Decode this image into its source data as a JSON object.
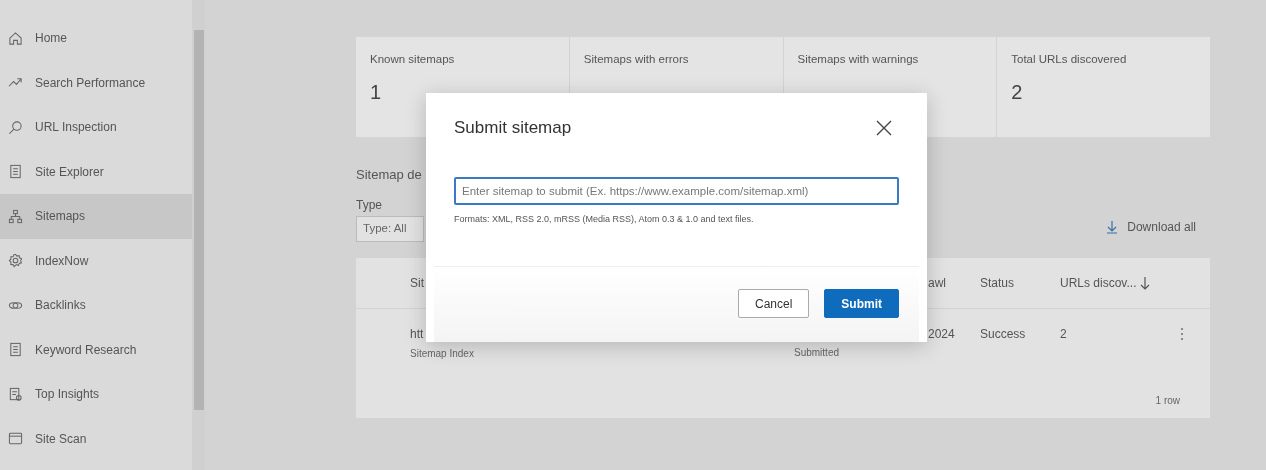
{
  "sidebar": {
    "items": [
      {
        "label": "Home",
        "selected": false
      },
      {
        "label": "Search Performance",
        "selected": false
      },
      {
        "label": "URL Inspection",
        "selected": false
      },
      {
        "label": "Site Explorer",
        "selected": false
      },
      {
        "label": "Sitemaps",
        "selected": true
      },
      {
        "label": "IndexNow",
        "selected": false
      },
      {
        "label": "Backlinks",
        "selected": false
      },
      {
        "label": "Keyword Research",
        "selected": false
      },
      {
        "label": "Top Insights",
        "selected": false
      },
      {
        "label": "Site Scan",
        "selected": false
      }
    ]
  },
  "stats": [
    {
      "label": "Known sitemaps",
      "value": "1"
    },
    {
      "label": "Sitemaps with errors"
    },
    {
      "label": "Sitemaps with warnings"
    },
    {
      "label": "Total URLs discovered",
      "value": "2"
    }
  ],
  "section_title": "Sitemap de",
  "type_filter": {
    "label": "Type",
    "value": "Type: All"
  },
  "download_all": "Download all",
  "table": {
    "columns": [
      "Sit",
      "awl",
      "Status",
      "URLs discov..."
    ],
    "rows": [
      {
        "site": "htt",
        "site_kind": "Sitemap Index",
        "submitted": "Submitted",
        "crawl": "2024",
        "status": "Success",
        "urls": "2"
      }
    ],
    "footer": "1 row"
  },
  "dialog": {
    "title": "Submit sitemap",
    "placeholder": "Enter sitemap to submit (Ex. https://www.example.com/sitemap.xml)",
    "hint": "Formats: XML, RSS 2.0, mRSS (Media RSS), Atom 0.3 & 1.0 and text files.",
    "buttons": [
      {
        "label": "Cancel",
        "kind": "secondary"
      },
      {
        "label": "Submit",
        "kind": "primary"
      }
    ]
  }
}
